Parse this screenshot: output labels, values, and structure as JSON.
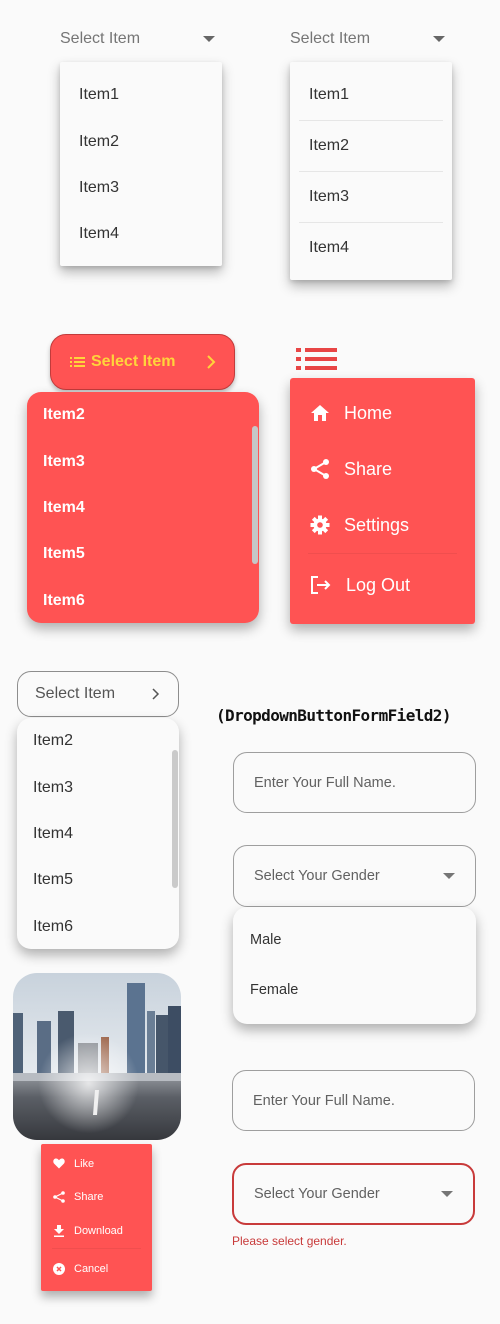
{
  "dropdown1": {
    "hint": "Select Item",
    "items": [
      "Item1",
      "Item2",
      "Item3",
      "Item4"
    ]
  },
  "dropdown2": {
    "hint": "Select Item",
    "items": [
      "Item1",
      "Item2",
      "Item3",
      "Item4"
    ]
  },
  "red_dropdown": {
    "hint": "Select Item",
    "items": [
      "Item2",
      "Item3",
      "Item4",
      "Item5",
      "Item6"
    ],
    "colors": {
      "background": "#ff5353",
      "text": "#ffd43b"
    }
  },
  "popup_menu": {
    "items": [
      {
        "icon": "home-icon",
        "label": "Home"
      },
      {
        "icon": "share-icon",
        "label": "Share"
      },
      {
        "icon": "settings-icon",
        "label": "Settings"
      },
      {
        "icon": "logout-icon",
        "label": "Log Out"
      }
    ]
  },
  "outlined_dropdown": {
    "hint": "Select Item",
    "items": [
      "Item2",
      "Item3",
      "Item4",
      "Item5",
      "Item6"
    ]
  },
  "form1": {
    "heading": "(DropdownButtonFormField2)",
    "name_placeholder": "Enter Your Full Name.",
    "gender_hint": "Select Your Gender",
    "gender_options": [
      "Male",
      "Female"
    ]
  },
  "image_menu": {
    "items": [
      {
        "icon": "heart-icon",
        "label": "Like"
      },
      {
        "icon": "share-icon",
        "label": "Share"
      },
      {
        "icon": "download-icon",
        "label": "Download"
      },
      {
        "icon": "cancel-icon",
        "label": "Cancel"
      }
    ]
  },
  "form2": {
    "name_placeholder": "Enter Your Full Name.",
    "gender_hint": "Select Your Gender",
    "error_text": "Please select gender.",
    "colors": {
      "error": "#c83a3a"
    }
  }
}
